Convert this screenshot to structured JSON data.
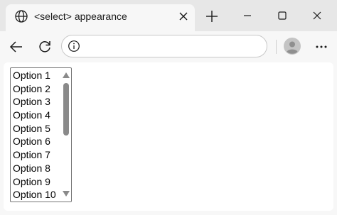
{
  "window": {
    "tab": {
      "title": "<select> appearance",
      "globe_icon": "globe-icon",
      "close_icon": "close-icon"
    },
    "new_tab_icon": "plus-icon",
    "controls": [
      "minimize-icon",
      "maximize-icon",
      "close-icon"
    ]
  },
  "toolbar": {
    "back_icon": "arrow-left-icon",
    "refresh_icon": "refresh-icon",
    "address": {
      "info_icon": "info-icon",
      "value": ""
    },
    "profile_icon": "avatar",
    "menu_icon": "more-icon"
  },
  "select": {
    "options": [
      "Option 1",
      "Option 2",
      "Option 3",
      "Option 4",
      "Option 5",
      "Option 6",
      "Option 7",
      "Option 8",
      "Option 9",
      "Option 10"
    ]
  },
  "colors": {
    "titlebar": "#e7e7e7",
    "toolbar": "#f7f7f7",
    "scroll_thumb": "#8a8a8a"
  }
}
